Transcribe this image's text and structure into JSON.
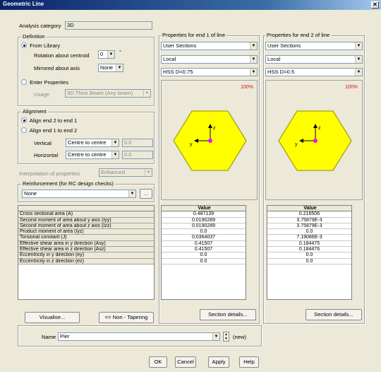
{
  "window": {
    "title": "Geometric Line",
    "close_glyph": "✕"
  },
  "analysis_category": {
    "label": "Analysis category",
    "value": "3D"
  },
  "definition": {
    "title": "Definition",
    "from_library": "From Library",
    "rotation_label": "Rotation about centroid",
    "rotation_value": "0",
    "rotation_unit": "°",
    "mirrored_label": "Mirrored about axis",
    "mirrored_value": "None",
    "enter_properties": "Enter Properties",
    "usage_label": "Usage",
    "usage_value": "3D Thick Beam (Any beam)"
  },
  "alignment": {
    "title": "Alignment",
    "opt1": "Align end 2 to end 1",
    "opt2": "Align end 1 to end 2",
    "vertical_label": "Vertical",
    "vertical_value": "Centre to centre",
    "vertical_offset": "0.0",
    "horizontal_label": "Horizontal",
    "horizontal_value": "Centre to centre",
    "horizontal_offset": "0.0"
  },
  "interpolation": {
    "label": "Interpolation of properties",
    "value": "Enhanced"
  },
  "reinforcement": {
    "title": "Reinforcement (for RC design checks)",
    "value": "None",
    "browse": "..."
  },
  "properties": {
    "labels": [
      "Cross sectional area (A)",
      "Second moment of area about y axis (Iyy)",
      "Second moment of area about z axis (Izz)",
      "Product moment of area (Iyz)",
      "Torsional constant (J)",
      "Effective shear area in y direction (Asy)",
      "Effective shear area in z direction (Asz)",
      "Eccentricity in y direction (ey)",
      "Eccentricity in z direction (ez)"
    ],
    "value_header": "Value"
  },
  "end1": {
    "title": "Properties for end 1 of line",
    "library": "User Sections",
    "scope": "Local",
    "section": "HSS D=0.75",
    "zoom": "100%",
    "axis_z": "z",
    "axis_y": "y",
    "values": [
      "0.487139",
      "0.0190289",
      "0.0190289",
      "0.0",
      "0.0364037",
      "0.41507",
      "0.41507",
      "0.0",
      "0.0"
    ],
    "details": "Section details..."
  },
  "end2": {
    "title": "Properties for end 2 of line",
    "library": "User Sections",
    "scope": "Local",
    "section": "HSS D=0.5",
    "zoom": "100%",
    "axis_z": "z",
    "axis_y": "y",
    "values": [
      "0.216506",
      "3.75879E-3",
      "3.75879E-3",
      "0.0",
      "7.19086E-3",
      "0.184475",
      "0.184476",
      "0.0",
      "0.0"
    ],
    "details": "Section details..."
  },
  "buttons": {
    "visualise": "Visualise...",
    "non_tapering": "<< Non - Tapering",
    "ok": "OK",
    "cancel": "Cancel",
    "apply": "Apply",
    "help": "Help"
  },
  "name": {
    "label": "Name",
    "value": "Pier",
    "new": "(new)"
  },
  "colors": {
    "section_fill": "#ffff00",
    "section_stroke": "#8a8a00",
    "centroid": "#ff00ff",
    "title_bar": "#0a246a"
  },
  "icons": [
    "close-icon",
    "dropdown-arrow-icon",
    "spinner-icon",
    "axis-arrow-icon"
  ]
}
